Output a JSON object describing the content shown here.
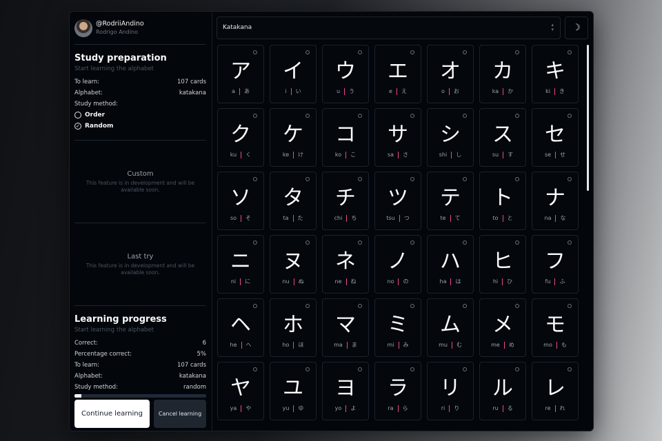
{
  "profile": {
    "handle": "@RodriiAndino",
    "name": "Rodrigo Andino"
  },
  "preparation": {
    "title": "Study preparation",
    "subtitle": "Start learning the alphabet",
    "to_learn_label": "To learn:",
    "to_learn_value": "107 cards",
    "alphabet_label": "Alphabet:",
    "alphabet_value": "katakana",
    "method_label": "Study method:",
    "option_order": "Order",
    "option_random": "Random",
    "selected_method": "Random"
  },
  "custom": {
    "title": "Custom",
    "desc": "This feature is in development and will be available soon."
  },
  "last_try": {
    "title": "Last try",
    "desc": "This feature is in development and will be available soon."
  },
  "progress": {
    "title": "Learning progress",
    "subtitle": "Start learning the alphabet",
    "correct_label": "Correct:",
    "correct_value": "6",
    "pct_label": "Percentage correct:",
    "pct_value": "5%",
    "to_learn_label": "To learn:",
    "to_learn_value": "107 cards",
    "alphabet_label": "Alphabet:",
    "alphabet_value": "katakana",
    "method_label": "Study method:",
    "method_value": "random",
    "bar_fraction": 0.05
  },
  "buttons": {
    "continue": "Continue learning",
    "cancel": "Cancel learning"
  },
  "selector": {
    "value": "Katakana"
  },
  "icons": {
    "theme": "moon-stars-icon",
    "selector": "chevron-up-down-icon"
  },
  "colors": {
    "accent": "#ec4899",
    "background": "#03060a"
  },
  "cards": [
    {
      "kana": "ア",
      "romaji": "a",
      "hira": "あ"
    },
    {
      "kana": "イ",
      "romaji": "i",
      "hira": "い"
    },
    {
      "kana": "ウ",
      "romaji": "u",
      "hira": "う"
    },
    {
      "kana": "エ",
      "romaji": "e",
      "hira": "え"
    },
    {
      "kana": "オ",
      "romaji": "o",
      "hira": "お"
    },
    {
      "kana": "カ",
      "romaji": "ka",
      "hira": "か"
    },
    {
      "kana": "キ",
      "romaji": "ki",
      "hira": "き"
    },
    {
      "kana": "ク",
      "romaji": "ku",
      "hira": "く"
    },
    {
      "kana": "ケ",
      "romaji": "ke",
      "hira": "け"
    },
    {
      "kana": "コ",
      "romaji": "ko",
      "hira": "こ"
    },
    {
      "kana": "サ",
      "romaji": "sa",
      "hira": "さ"
    },
    {
      "kana": "シ",
      "romaji": "shi",
      "hira": "し"
    },
    {
      "kana": "ス",
      "romaji": "su",
      "hira": "す"
    },
    {
      "kana": "セ",
      "romaji": "se",
      "hira": "せ"
    },
    {
      "kana": "ソ",
      "romaji": "so",
      "hira": "そ"
    },
    {
      "kana": "タ",
      "romaji": "ta",
      "hira": "た"
    },
    {
      "kana": "チ",
      "romaji": "chi",
      "hira": "ち"
    },
    {
      "kana": "ツ",
      "romaji": "tsu",
      "hira": "つ"
    },
    {
      "kana": "テ",
      "romaji": "te",
      "hira": "て"
    },
    {
      "kana": "ト",
      "romaji": "to",
      "hira": "と"
    },
    {
      "kana": "ナ",
      "romaji": "na",
      "hira": "な"
    },
    {
      "kana": "ニ",
      "romaji": "ni",
      "hira": "に"
    },
    {
      "kana": "ヌ",
      "romaji": "nu",
      "hira": "ぬ"
    },
    {
      "kana": "ネ",
      "romaji": "ne",
      "hira": "ね"
    },
    {
      "kana": "ノ",
      "romaji": "no",
      "hira": "の"
    },
    {
      "kana": "ハ",
      "romaji": "ha",
      "hira": "は"
    },
    {
      "kana": "ヒ",
      "romaji": "hi",
      "hira": "ひ"
    },
    {
      "kana": "フ",
      "romaji": "fu",
      "hira": "ふ"
    },
    {
      "kana": "ヘ",
      "romaji": "he",
      "hira": "へ"
    },
    {
      "kana": "ホ",
      "romaji": "ho",
      "hira": "ほ"
    },
    {
      "kana": "マ",
      "romaji": "ma",
      "hira": "ま"
    },
    {
      "kana": "ミ",
      "romaji": "mi",
      "hira": "み"
    },
    {
      "kana": "ム",
      "romaji": "mu",
      "hira": "む"
    },
    {
      "kana": "メ",
      "romaji": "me",
      "hira": "め"
    },
    {
      "kana": "モ",
      "romaji": "mo",
      "hira": "も"
    },
    {
      "kana": "ヤ",
      "romaji": "ya",
      "hira": "や"
    },
    {
      "kana": "ユ",
      "romaji": "yu",
      "hira": "ゆ"
    },
    {
      "kana": "ヨ",
      "romaji": "yo",
      "hira": "よ"
    },
    {
      "kana": "ラ",
      "romaji": "ra",
      "hira": "ら"
    },
    {
      "kana": "リ",
      "romaji": "ri",
      "hira": "り"
    },
    {
      "kana": "ル",
      "romaji": "ru",
      "hira": "る"
    },
    {
      "kana": "レ",
      "romaji": "re",
      "hira": "れ"
    }
  ]
}
